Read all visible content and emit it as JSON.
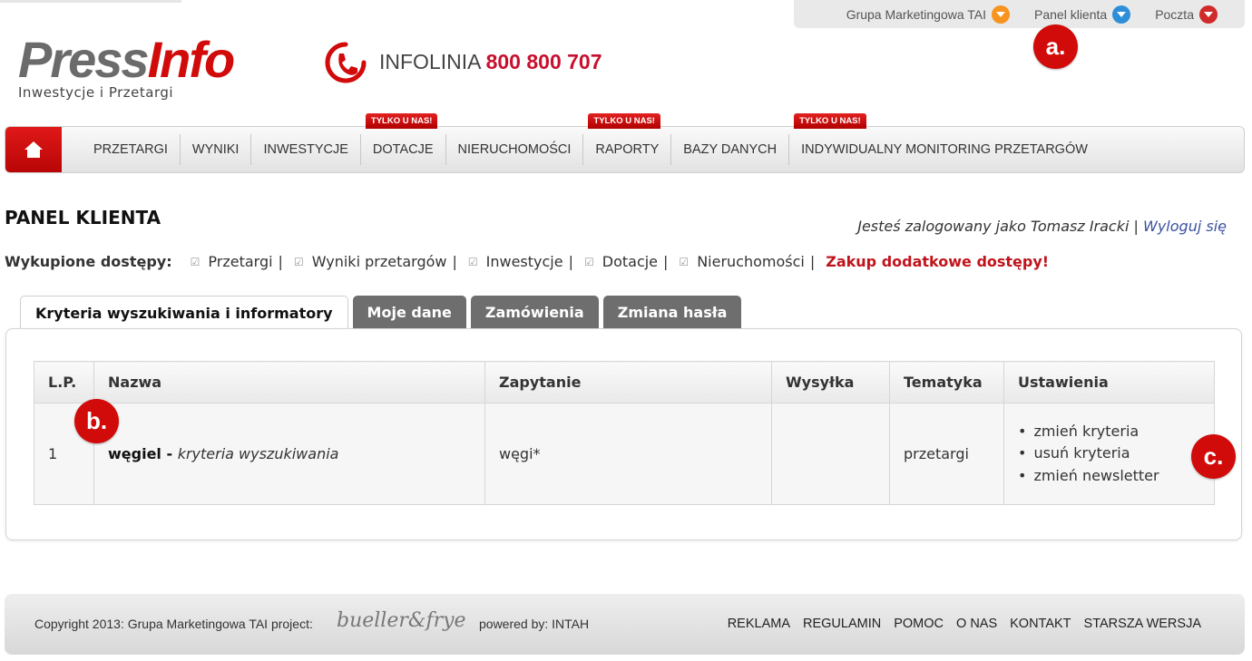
{
  "top_links": [
    {
      "label": "Grupa Marketingowa TAI",
      "color": "#f7931e"
    },
    {
      "label": "Panel klienta",
      "color": "#2e8fd8"
    },
    {
      "label": "Poczta",
      "color": "#d12a2a"
    }
  ],
  "markers": {
    "a": "a.",
    "b": "b.",
    "c": "c."
  },
  "header": {
    "logo_press": "Press",
    "logo_info": "Info",
    "logo_sub": "Inwestycje i Przetargi",
    "hotline_label": "INFOLINIA",
    "hotline_number": "800 800 707"
  },
  "nav": {
    "items": [
      {
        "label": "PRZETARGI",
        "badge": ""
      },
      {
        "label": "WYNIKI",
        "badge": ""
      },
      {
        "label": "INWESTYCJE",
        "badge": ""
      },
      {
        "label": "DOTACJE",
        "badge": "TYLKO U NAS!"
      },
      {
        "label": "NIERUCHOMOŚCI",
        "badge": ""
      },
      {
        "label": "RAPORTY",
        "badge": "TYLKO U NAS!"
      },
      {
        "label": "BAZY DANYCH",
        "badge": ""
      },
      {
        "label": "INDYWIDUALNY MONITORING PRZETARGÓW",
        "badge": "TYLKO U NAS!"
      }
    ]
  },
  "panel": {
    "title": "PANEL KLIENTA",
    "logged_in": "Jesteś zalogowany jako Tomasz Iracki",
    "separator": "|",
    "logout": "Wyloguj się",
    "access_label": "Wykupione dostępy:",
    "access_items": [
      "Przetargi",
      "Wyniki przetargów",
      "Inwestycje",
      "Dotacje",
      "Nieruchomości"
    ],
    "buy_more": "Zakup dodatkowe dostępy!"
  },
  "tabs": [
    {
      "label": "Kryteria wyszukiwania i informatory",
      "active": true
    },
    {
      "label": "Moje dane",
      "active": false
    },
    {
      "label": "Zamówienia",
      "active": false
    },
    {
      "label": "Zmiana hasła",
      "active": false
    }
  ],
  "table": {
    "headers": [
      "L.P.",
      "Nazwa",
      "Zapytanie",
      "Wysyłka",
      "Tematyka",
      "Ustawienia"
    ],
    "rows": [
      {
        "lp": "1",
        "name": "węgiel",
        "name_sep": " - ",
        "desc": "kryteria wyszukiwania",
        "query": "węgi*",
        "shipping": "",
        "topic": "przetargi",
        "settings": [
          "zmień kryteria",
          "usuń kryteria",
          "zmień newsletter"
        ]
      }
    ]
  },
  "footer": {
    "copyright": "Copyright 2013: Grupa Marketingowa TAI project:",
    "project_logo": "bueller&frye",
    "powered": "powered by: INTAH",
    "links": [
      "REKLAMA",
      "REGULAMIN",
      "POMOC",
      "O NAS",
      "KONTAKT",
      "STARSZA WERSJA"
    ]
  }
}
